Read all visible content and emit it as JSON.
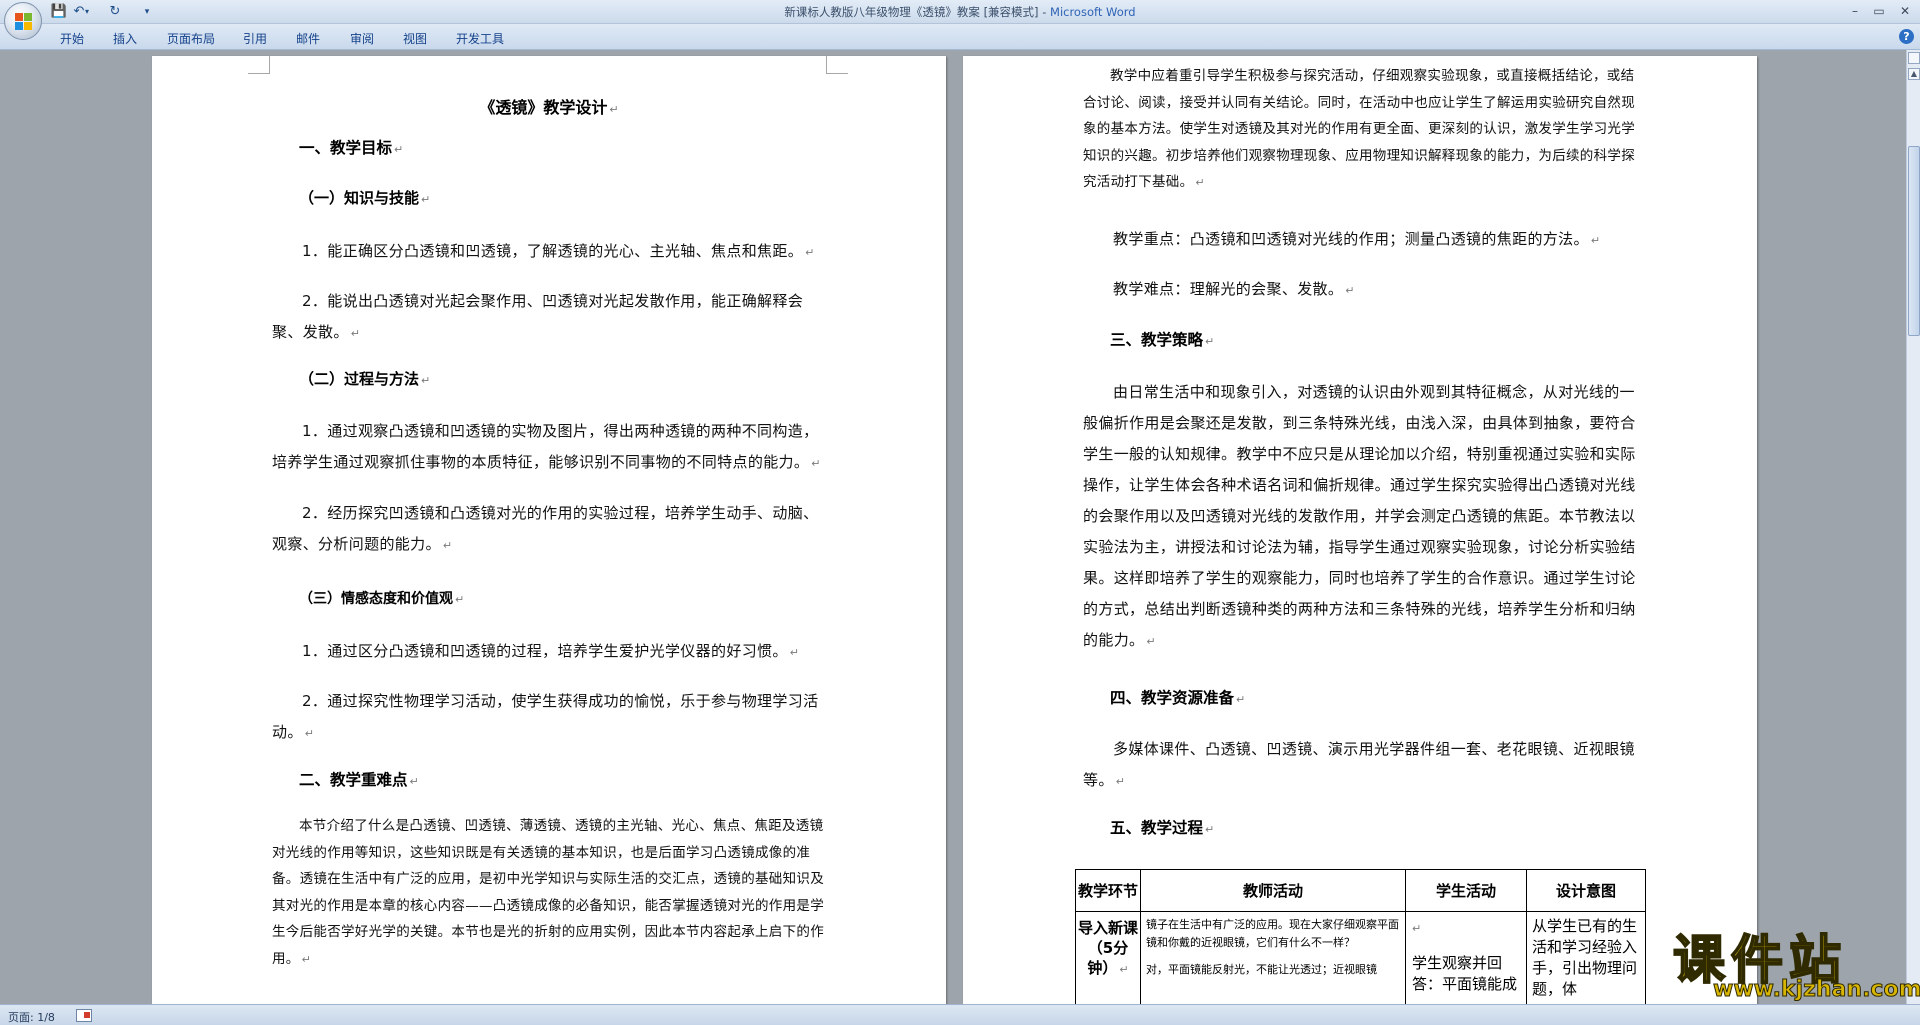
{
  "window": {
    "title": "新课标人教版八年级物理《透镜》教案 [兼容模式] - ",
    "app_name": "Microsoft Word"
  },
  "ribbon": {
    "tabs": [
      "开始",
      "插入",
      "页面布局",
      "引用",
      "邮件",
      "审阅",
      "视图",
      "开发工具"
    ]
  },
  "qat": {
    "save": "💾",
    "undo": "↶",
    "redo": "↻",
    "customize": "▾"
  },
  "window_buttons": {
    "minimize": "–",
    "maximize": "▭",
    "close": "✕"
  },
  "help": "?",
  "page1": {
    "title": "《透镜》教学设计",
    "sec1": "一、教学目标",
    "sub1": "（一）知识与技能",
    "p1": "1．能正确区分凸透镜和凹透镜，了解透镜的光心、主光轴、焦点和焦距。",
    "p2": "2．能说出凸透镜对光起会聚作用、凹透镜对光起发散作用，能正确解释会聚、发散。",
    "sub2": "（二）过程与方法",
    "p3": "1．通过观察凸透镜和凹透镜的实物及图片，得出两种透镜的两种不同构造，培养学生通过观察抓住事物的本质特征，能够识别不同事物的不同特点的能力。",
    "p4": "2．经历探究凹透镜和凸透镜对光的作用的实验过程，培养学生动手、动脑、观察、分析问题的能力。",
    "sub3": "（三）情感态度和价值观",
    "p5": "1．通过区分凸透镜和凹透镜的过程，培养学生爱护光学仪器的好习惯。",
    "p6": "2．通过探究性物理学习活动，使学生获得成功的愉悦，乐于参与物理学习活动。",
    "sec2": "二、教学重难点",
    "p7": "本节介绍了什么是凸透镜、凹透镜、薄透镜、透镜的主光轴、光心、焦点、焦距及透镜对光线的作用等知识，这些知识既是有关透镜的基本知识，也是后面学习凸透镜成像的准备。透镜在生活中有广泛的应用，是初中光学知识与实际生活的交汇点，透镜的基础知识及其对光的作用是本章的核心内容——凸透镜成像的必备知识，能否掌握透镜对光的作用是学生今后能否学好光学的关键。本节也是光的折射的应用实例，因此本节内容起承上启下的作用。"
  },
  "page2": {
    "p1": "教学中应着重引导学生积极参与探究活动，仔细观察实验现象，或直接概括结论，或结合讨论、阅读，接受并认同有关结论。同时，在活动中也应让学生了解运用实验研究自然现象的基本方法。使学生对透镜及其对光的作用有更全面、更深刻的认识，激发学生学习光学知识的兴趣。初步培养他们观察物理现象、应用物理知识解释现象的能力，为后续的科学探究活动打下基础。",
    "p2": "教学重点：凸透镜和凹透镜对光线的作用；测量凸透镜的焦距的方法。",
    "p3": "教学难点：理解光的会聚、发散。",
    "sec3": "三、教学策略",
    "p4": "由日常生活中和现象引入，对透镜的认识由外观到其特征概念，从对光线的一般偏折作用是会聚还是发散，到三条特殊光线，由浅入深，由具体到抽象，要符合学生一般的认知规律。教学中不应只是从理论加以介绍，特别重视通过实验和实际操作，让学生体会各种术语名词和偏折规律。通过学生探究实验得出凸透镜对光线的会聚作用以及凹透镜对光线的发散作用，并学会测定凸透镜的焦距。本节教法以实验法为主，讲授法和讨论法为辅，指导学生通过观察实验现象，讨论分析实验结果。这样即培养了学生的观察能力，同时也培养了学生的合作意识。通过学生讨论的方式，总结出判断透镜种类的两种方法和三条特殊的光线，培养学生分析和归纳的能力。",
    "sec4": "四、教学资源准备",
    "p5": "多媒体课件、凸透镜、凹透镜、演示用光学器件组一套、老花眼镜、近视眼镜等。",
    "sec5": "五、教学过程",
    "table": {
      "headers": [
        "教学环节",
        "教师活动",
        "学生活动",
        "设计意图"
      ],
      "row1": {
        "stage": "导入新课（5分钟）",
        "teacher1": "镜子在生活中有广泛的应用。现在大家仔细观察平面镜和你戴的近视眼镜，它们有什么不一样？",
        "teacher2": "对，平面镜能反射光，不能让光透过；近视眼镜",
        "student": "学生观察并回答：平面镜能成",
        "design": "从学生已有的生活和学习经验入手，引出物理问题，体"
      }
    }
  },
  "status": {
    "page": "页面: 1/8"
  },
  "watermark": {
    "text": "课件站",
    "url": "www.kjzhan.com"
  },
  "para_mark": "↵"
}
